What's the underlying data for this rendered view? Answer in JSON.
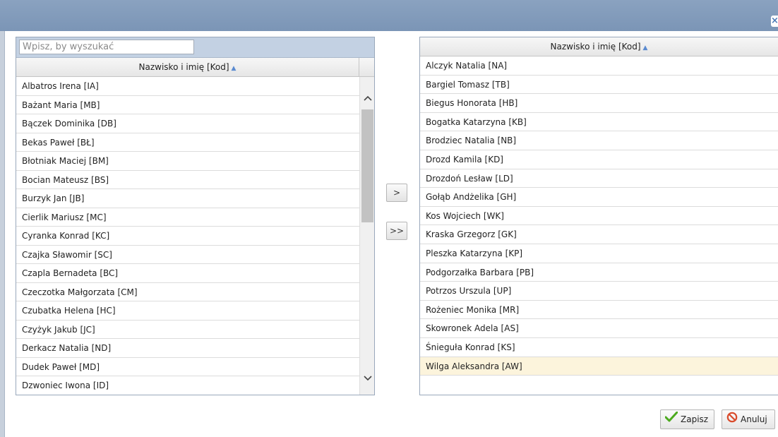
{
  "window": {
    "close_label": "×"
  },
  "left_panel": {
    "search_placeholder": "Wpisz, by wyszukać",
    "column_header": "Nazwisko i imię [Kod]",
    "rows": [
      "Albatros Irena [IA]",
      "Bażant Maria [MB]",
      "Bączek Dominika [DB]",
      "Bekas Paweł [BŁ]",
      "Błotniak Maciej [BM]",
      "Bocian Mateusz [BS]",
      "Burzyk Jan [JB]",
      "Cierlik Mariusz [MC]",
      "Cyranka Konrad [KC]",
      "Czajka Sławomir [SC]",
      "Czapla Bernadeta [BC]",
      "Czeczotka Małgorzata [CM]",
      "Czubatka Helena [HC]",
      "Czyżyk Jakub [JC]",
      "Derkacz Natalia [ND]",
      "Dudek Paweł [MD]",
      "Dzwoniec Iwona [ID]"
    ]
  },
  "transfer": {
    "move_one_label": ">",
    "move_all_label": ">>"
  },
  "right_panel": {
    "column_header": "Nazwisko i imię [Kod]",
    "rows": [
      "Alczyk Natalia [NA]",
      "Bargiel Tomasz [TB]",
      "Biegus Honorata [HB]",
      "Bogatka Katarzyna [KB]",
      "Brodziec Natalia [NB]",
      "Drozd Kamila [KD]",
      "Drozdoń Lesław [LD]",
      "Gołąb Andżelika [GH]",
      "Kos Wojciech [WK]",
      "Kraska Grzegorz [GK]",
      "Pleszka Katarzyna [KP]",
      "Podgorzałka Barbara [PB]",
      "Potrzos Urszula [UP]",
      "Rożeniec Monika [MR]",
      "Skowronek Adela [AS]",
      "Śnieguła Konrad [KS]",
      "Wilga Aleksandra [AW]"
    ],
    "selected_index": 16
  },
  "actions": {
    "save_label": "Zapisz",
    "cancel_label": "Anuluj"
  },
  "colors": {
    "titlebar": "#7b95b6",
    "selected_row": "#fcf4dc",
    "save_icon": "#4caa1e",
    "cancel_icon": "#d94a2a",
    "sort_arrow": "#5a8ad0"
  },
  "icons": {
    "sort": "triangle-up-icon",
    "save": "check-icon",
    "cancel": "no-entry-icon"
  }
}
